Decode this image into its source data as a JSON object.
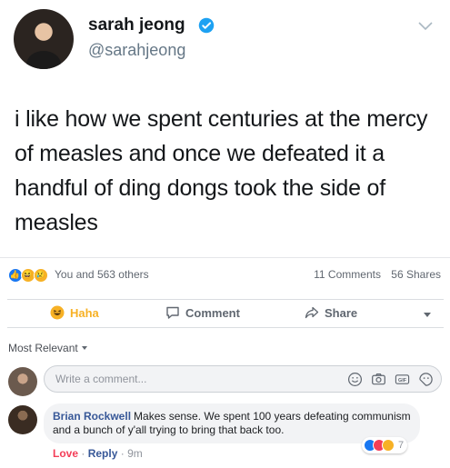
{
  "tweet": {
    "name": "sarah jeong",
    "handle": "@sarahjeong",
    "text": "i like how we spent centuries at the mercy of measles and once we defeated it a handful of ding dongs took the side of measles"
  },
  "post_stats": {
    "reactors": "You and 563 others",
    "comments": "11 Comments",
    "shares": "56 Shares"
  },
  "actions": {
    "haha": "Haha",
    "comment": "Comment",
    "share": "Share"
  },
  "sort": {
    "label": "Most Relevant"
  },
  "composer": {
    "placeholder": "Write a comment..."
  },
  "comment": {
    "author": "Brian Rockwell",
    "text": "Makes sense. We spent 100 years defeating communism and a bunch of y'all trying to bring that back too.",
    "reaction_count": "7",
    "love": "Love",
    "separator": "·",
    "reply": "Reply",
    "time": "9m"
  },
  "colors": {
    "verified": "#1da1f2",
    "fb_link": "#385898",
    "like": "#1877f2",
    "haha": "#f7b125",
    "love": "#f33e58"
  }
}
